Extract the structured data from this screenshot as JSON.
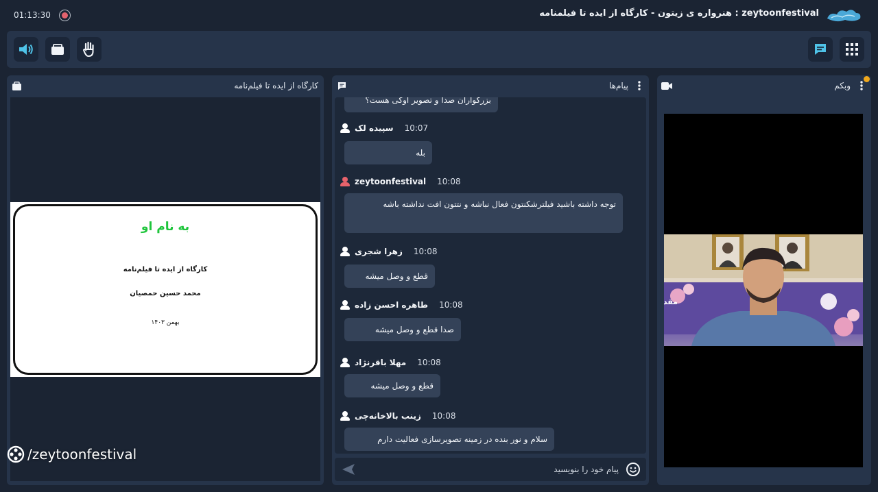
{
  "topbar": {
    "timer": "01:13:30",
    "room_title": "zeytoonfestival : هنرواره ی زیتون - کارگاه از ایده تا فیلمنامه"
  },
  "toolbar": {
    "left_buttons": [
      "speaker-icon",
      "share-screen-icon",
      "raise-hand-icon"
    ],
    "right_buttons": [
      "chat-icon",
      "apps-grid-icon"
    ]
  },
  "presentation": {
    "title": "کارگاه از ایده تا فیلم‌نامه",
    "slide": {
      "heading": "به نام او",
      "line1": "کارگاه از ایده تا فیلم‌نامه",
      "line2": "محمد حسین حمصیان",
      "line3": "بهمن ۱۴۰۳"
    },
    "watermark": "/zeytoonfestival"
  },
  "chat": {
    "title": "پیام‌ها",
    "partial_message": "بزرگواران صدا و تصویر اوکی هست؟",
    "messages": [
      {
        "sender": "سپیده لک",
        "time": "10:07",
        "text": "بله",
        "avatar": "white"
      },
      {
        "sender": "zeytoonfestival",
        "time": "10:08",
        "text": "توجه داشته باشید فیلترشکنتون فعال نباشه و نتتون افت نداشته باشه",
        "avatar": "red"
      },
      {
        "sender": "زهرا شجری",
        "time": "10:08",
        "text": "قطع و وصل میشه",
        "avatar": "white"
      },
      {
        "sender": "طاهره احسن زاده",
        "time": "10:08",
        "text": "صدا قطع و وصل میشه",
        "avatar": "white"
      },
      {
        "sender": "مهلا باقرنژاد",
        "time": "10:08",
        "text": "قطع و وصل میشه",
        "avatar": "white"
      },
      {
        "sender": "زینب بالاخانه‌چی",
        "time": "10:08",
        "text": "سلام و نور بنده در زمینه تصویرسازی فعالیت دارم",
        "avatar": "white"
      }
    ],
    "input_placeholder": "پیام خود را بنویسید"
  },
  "webcam": {
    "title": "وبکم",
    "banner_text": "مقدم ... چند را"
  },
  "colors": {
    "background": "#1b2433",
    "panel": "#26344a",
    "bubble": "#344258",
    "accent": "#4fc3e8",
    "slide_heading": "#1fc53c",
    "notification": "#f0a81c",
    "record": "#e2636e"
  }
}
